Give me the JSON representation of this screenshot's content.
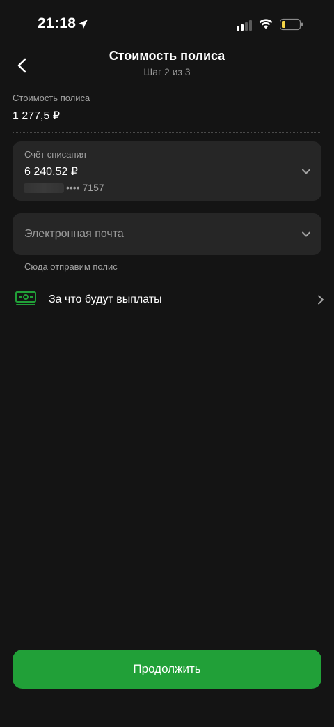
{
  "status_bar": {
    "time": "21:18"
  },
  "header": {
    "title": "Стоимость полиса",
    "subtitle": "Шаг 2 из 3"
  },
  "price": {
    "label": "Стоимость полиса",
    "value": "1 277,5 ₽"
  },
  "account": {
    "label": "Счёт списания",
    "balance": "6 240,52 ₽",
    "card_number": "•••• 7157"
  },
  "email": {
    "placeholder": "Электронная почта",
    "hint": "Сюда отправим полис"
  },
  "payouts": {
    "label": "За что будут выплаты",
    "icon": "money-icon"
  },
  "actions": {
    "continue_label": "Продолжить"
  },
  "colors": {
    "background": "#141414",
    "card": "#262626",
    "accent": "#21a038",
    "battery_low": "#f5d547"
  }
}
